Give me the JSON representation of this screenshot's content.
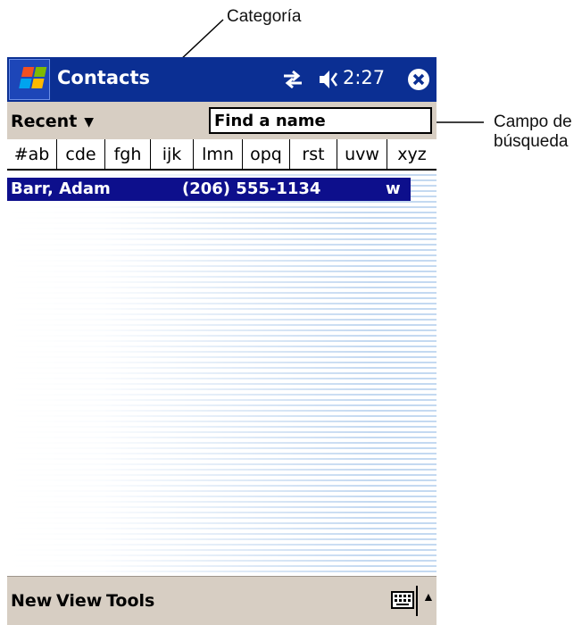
{
  "annotations": {
    "category_label": "Categoría",
    "search_label_line1": "Campo de",
    "search_label_line2": "búsqueda"
  },
  "titlebar": {
    "app_title": "Contacts",
    "time": "2:27",
    "icons": [
      "windows-start-icon",
      "sync-icon",
      "speaker-icon",
      "close-icon"
    ]
  },
  "category": {
    "selected": "Recent"
  },
  "search": {
    "placeholder": "Find a name"
  },
  "alphabet_tabs": [
    "#ab",
    "cde",
    "fgh",
    "ijk",
    "lmn",
    "opq",
    "rst",
    "uvw",
    "xyz"
  ],
  "contacts": [
    {
      "name": "Barr, Adam",
      "phone": "(206) 555-1134",
      "type": "w"
    }
  ],
  "menu": {
    "items": [
      "New",
      "View",
      "Tools"
    ]
  },
  "colors": {
    "titlebar": "#0b2f93",
    "toolbar": "#d7cec3",
    "selection": "#0d0f8c",
    "stripe": "#c4d9f1"
  }
}
